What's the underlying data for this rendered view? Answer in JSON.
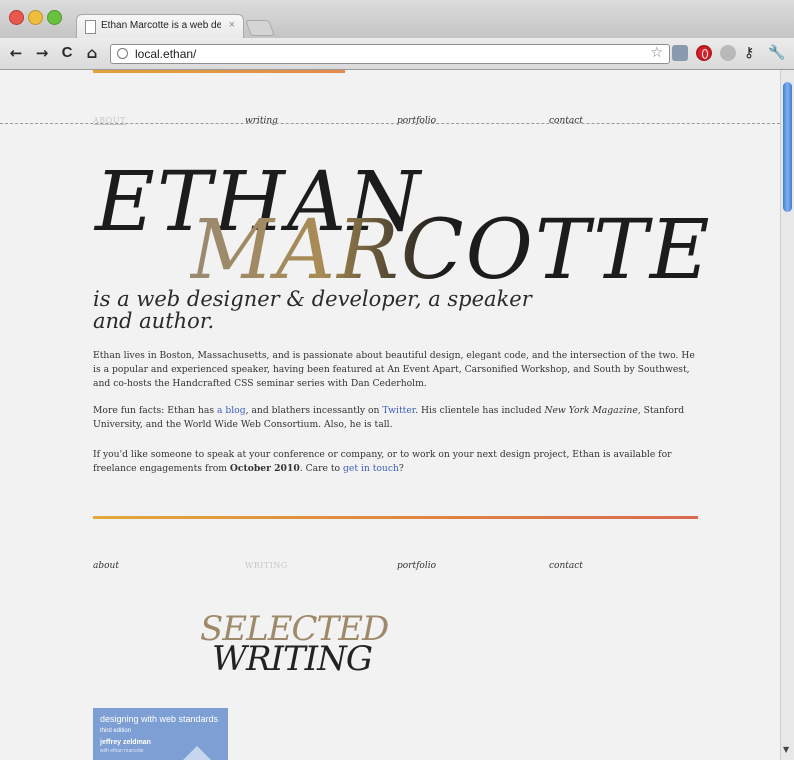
{
  "browser": {
    "tab_title": "Ethan Marcotte is a web desi",
    "tab_close": "×",
    "url": "local.ethan/",
    "back": "←",
    "forward": "→",
    "reload": "C",
    "home": "⌂",
    "star": "☆",
    "key": "⚷",
    "wrench": "🔧"
  },
  "nav_top": {
    "items": [
      "ABOUT",
      "writing",
      "portfolio",
      "contact"
    ],
    "active_index": 0
  },
  "hero": {
    "first_name": "ETHAN",
    "last_name": "MARCOTTE"
  },
  "tagline": "is a web designer & developer, a speaker and author.",
  "about": {
    "p1": "Ethan lives in Boston, Massachusetts, and is passionate about beautiful design, elegant code, and the intersection of the two. He is a popular and experienced speaker, having been featured at An Event Apart, Carsonified Workshop, and South by Southwest, and co-hosts the Handcrafted CSS seminar series with Dan Cederholm.",
    "p2_before_blog": "More fun facts: Ethan has ",
    "p2_blog": "a blog",
    "p2_between": ", and blathers incessantly on ",
    "p2_twitter": "Twitter",
    "p2_after_twitter": ". His clientele has included ",
    "p2_nym": "New York Magazine",
    "p2_end": ", Stanford University, and the World Wide Web Consortium. Also, he is tall.",
    "p3_start": "If you'd like someone to speak at your conference or company, or to work on your next design project, Ethan is available for freelance engagements from ",
    "p3_date": "October 2010",
    "p3_mid": ". Care to ",
    "p3_link": "get in touch",
    "p3_end": "?"
  },
  "nav_second": {
    "items": [
      "about",
      "WRITING",
      "portfolio",
      "contact"
    ],
    "active_index": 1
  },
  "writing": {
    "title_line1": "SELECTED",
    "title_line2": "WRITING",
    "book_title": "designing with web standards",
    "book_edition": "third edition",
    "book_author": "jeffrey zeldman",
    "book_subtitle": "with ethan marcotte"
  },
  "colors": {
    "link": "#3a5fb8",
    "accent_start": "#e2a83b",
    "accent_end": "#d96a52",
    "book_blue": "#7e9fd3"
  }
}
